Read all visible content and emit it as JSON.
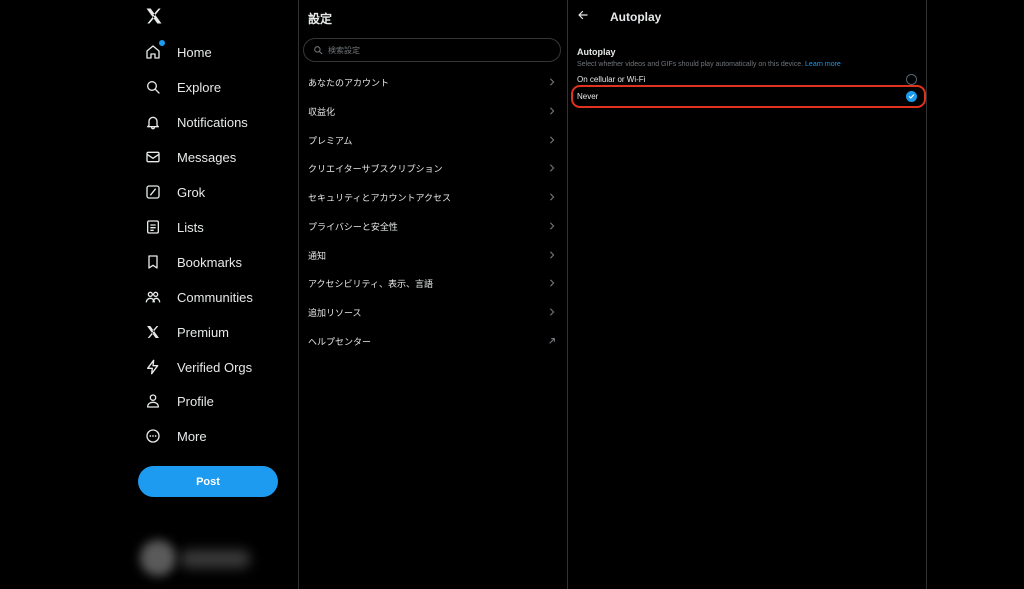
{
  "nav": {
    "items": [
      {
        "label": "Home",
        "icon": "home-icon"
      },
      {
        "label": "Explore",
        "icon": "search-icon"
      },
      {
        "label": "Notifications",
        "icon": "bell-icon"
      },
      {
        "label": "Messages",
        "icon": "envelope-icon"
      },
      {
        "label": "Grok",
        "icon": "grok-icon"
      },
      {
        "label": "Lists",
        "icon": "list-icon"
      },
      {
        "label": "Bookmarks",
        "icon": "bookmark-icon"
      },
      {
        "label": "Communities",
        "icon": "people-icon"
      },
      {
        "label": "Premium",
        "icon": "x-logo-icon"
      },
      {
        "label": "Verified Orgs",
        "icon": "lightning-icon"
      },
      {
        "label": "Profile",
        "icon": "person-icon"
      },
      {
        "label": "More",
        "icon": "more-circle-icon"
      }
    ],
    "post_label": "Post"
  },
  "settings": {
    "title": "設定",
    "search_placeholder": "検索設定",
    "items": [
      {
        "label": "あなたのアカウント",
        "icon": "chevron-right-icon"
      },
      {
        "label": "収益化",
        "icon": "chevron-right-icon"
      },
      {
        "label": "プレミアム",
        "icon": "chevron-right-icon"
      },
      {
        "label": "クリエイターサブスクリプション",
        "icon": "chevron-right-icon"
      },
      {
        "label": "セキュリティとアカウントアクセス",
        "icon": "chevron-right-icon"
      },
      {
        "label": "プライバシーと安全性",
        "icon": "chevron-right-icon"
      },
      {
        "label": "通知",
        "icon": "chevron-right-icon"
      },
      {
        "label": "アクセシビリティ、表示、言語",
        "icon": "chevron-right-icon"
      },
      {
        "label": "追加リソース",
        "icon": "chevron-right-icon"
      },
      {
        "label": "ヘルプセンター",
        "icon": "external-arrow-icon"
      }
    ]
  },
  "autoplay": {
    "title": "Autoplay",
    "section_title": "Autoplay",
    "description": "Select whether videos and GIFs should play automatically on this device.",
    "learn_more": "Learn more",
    "options": [
      {
        "label": "On cellular or Wi-Fi",
        "selected": false
      },
      {
        "label": "Never",
        "selected": true
      }
    ]
  },
  "colors": {
    "accent": "#1d9bf0",
    "highlight": "#e0321c",
    "background": "#000000"
  }
}
